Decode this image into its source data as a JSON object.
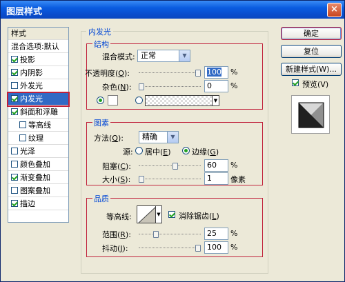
{
  "window": {
    "title": "图层样式",
    "close_glyph": "×"
  },
  "styles_list": {
    "header": "样式",
    "blend_options": "混合选项:默认",
    "items": [
      {
        "label": "投影",
        "checked": true
      },
      {
        "label": "内阴影",
        "checked": true
      },
      {
        "label": "外发光",
        "checked": false
      },
      {
        "label": "内发光",
        "checked": true,
        "selected": true
      },
      {
        "label": "斜面和浮雕",
        "checked": true
      },
      {
        "label": "等高线",
        "checked": false,
        "indent": true
      },
      {
        "label": "纹理",
        "checked": false,
        "indent": true
      },
      {
        "label": "光泽",
        "checked": false
      },
      {
        "label": "颜色叠加",
        "checked": false
      },
      {
        "label": "渐变叠加",
        "checked": true
      },
      {
        "label": "图案叠加",
        "checked": false
      },
      {
        "label": "描边",
        "checked": true
      }
    ]
  },
  "panel": {
    "title": "内发光",
    "structure": {
      "title": "结构",
      "blend_mode_label": "混合模式:",
      "blend_mode_value": "正常",
      "opacity_label": "不透明度(",
      "opacity_key": "O",
      "opacity_value": "100",
      "opacity_percent": 1.0,
      "noise_label": "杂色(",
      "noise_key": "N",
      "noise_value": "0",
      "noise_percent": 0,
      "percent_sign": "%",
      "label_close": "):"
    },
    "elements": {
      "title": "图素",
      "method_label": "方法(",
      "method_key": "Q",
      "method_value": "精确",
      "source_label": "源:",
      "center_label": "居中(",
      "center_key": "E",
      "edge_label": "边缘(",
      "edge_key": "G",
      "choke_label": "阻塞(",
      "choke_key": "C",
      "choke_value": "60",
      "choke_percent": 0.6,
      "size_label": "大小(",
      "size_key": "S",
      "size_value": "1",
      "size_unit": "像素",
      "size_percent": 0.0,
      "percent_sign": "%",
      "label_close": "):",
      "paren_close": ")"
    },
    "quality": {
      "title": "品质",
      "contour_label": "等高线:",
      "antialias_label": "消除锯齿(",
      "antialias_key": "L",
      "antialias_checked": true,
      "range_label": "范围(",
      "range_key": "R",
      "range_value": "25",
      "range_percent": 0.25,
      "jitter_label": "抖动(",
      "jitter_key": "J",
      "jitter_value": "100",
      "jitter_percent": 1.0,
      "percent_sign": "%",
      "label_close": "):",
      "paren_close": ")"
    }
  },
  "buttons": {
    "ok": "确定",
    "reset": "复位",
    "new_style": "新建样式(W)...",
    "preview_label": "预览(V)",
    "preview_checked": true
  },
  "colors": {
    "accent": "#316ac5",
    "group_border": "#c0203a",
    "title_blue": "#0046d5"
  }
}
